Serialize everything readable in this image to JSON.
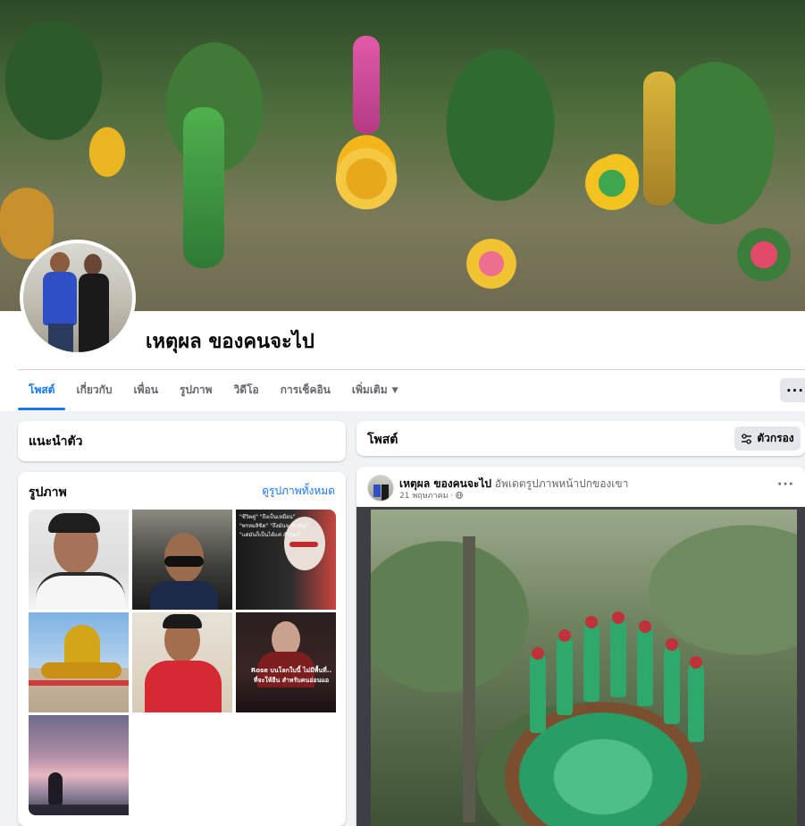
{
  "profile": {
    "name": "เหตุผล ของคนจะไป"
  },
  "tabs": [
    {
      "label": "โพสต์",
      "active": true
    },
    {
      "label": "เกี่ยวกับ",
      "active": false
    },
    {
      "label": "เพื่อน",
      "active": false
    },
    {
      "label": "รูปภาพ",
      "active": false
    },
    {
      "label": "วิดีโอ",
      "active": false
    },
    {
      "label": "การเช็คอิน",
      "active": false
    },
    {
      "label": "เพิ่มเติม",
      "active": false
    }
  ],
  "more_menu": "···",
  "intro": {
    "title": "แนะนำตัว"
  },
  "photos": {
    "title": "รูปภาพ",
    "see_all": "ดูรูปภาพทั้งหมด",
    "items": [
      {
        "caption": ""
      },
      {
        "caption": ""
      },
      {
        "caption": "\"ชีวิตคู่\" \"ถึงเป็นเหมือน\" \"พรหมลิขิต\" \"ถึงมันจะสำคัญ\" \"แต่มันก็เป็นได้แค่ สำรอง\""
      },
      {
        "caption": ""
      },
      {
        "caption": ""
      },
      {
        "caption": "Rose บนโลกใบนี้ ไม่มีพื้นที่.. ที่จะให้ยืน สำหรับคนอ่อนแอ"
      },
      {
        "caption": ""
      }
    ]
  },
  "posts_header": {
    "title": "โพสต์",
    "filter_label": "ตัวกรอง"
  },
  "post": {
    "author": "เหตุผล ของคนจะไป",
    "action": "อัพเดตรูปภาพหน้าปกของเขา",
    "date": "21 พฤษภาคม · ",
    "menu": "···"
  },
  "colors": {
    "accent": "#1877f2",
    "background": "#f0f2f5",
    "secondary_text": "#65676b"
  }
}
